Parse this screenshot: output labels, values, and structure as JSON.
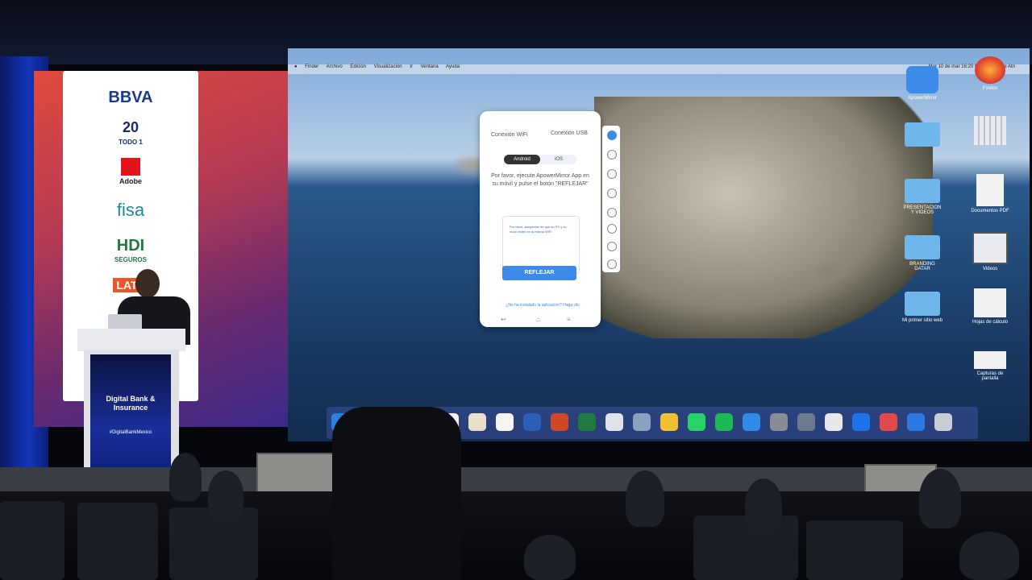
{
  "sponsors": {
    "bbva": "BBVA",
    "todo1_number": "20",
    "todo1_text": "TODO 1",
    "adobe": "Adobe",
    "fisa": "fisa",
    "hdi": "HDI",
    "hdi_sub": "SEGUROS",
    "latam": "LATA"
  },
  "podium": {
    "event_title": "Digital Bank & Insurance",
    "hashtag": "#DigitalBankMexico"
  },
  "mac": {
    "menubar": [
      "Finder",
      "Archivo",
      "Edición",
      "Visualización",
      "Ir",
      "Ventana",
      "Ayuda"
    ],
    "status": "Mar 10 de mar 16:20  Nathan Zetune Atri"
  },
  "app_dialog": {
    "tab_wifi": "Conexión WiFi",
    "tab_usb": "Conexión USB",
    "os_android": "Android",
    "os_ios": "iOS",
    "instructions": "Por favor, ejecute ApowerMirror App en su móvil y pulse el botón \"REFLEJAR\"",
    "wifi_note": "Por favor, asegúrese de que su PC y su móvil estén en la misma WiFi",
    "button": "REFLEJAR",
    "help_link": "¿No ha instalado la aplicación? Haga clic"
  },
  "desktop_icons": [
    {
      "label": "ApowerMirror",
      "icon": "apowermirror-icon"
    },
    {
      "label": "Firefox",
      "icon": "firefox-icon"
    },
    {
      "label": "",
      "icon": "folder-icon"
    },
    {
      "label": "",
      "icon": "grid-app-icon"
    },
    {
      "label": "PRESENTACION Y VIDEOS",
      "icon": "folder-icon"
    },
    {
      "label": "Documentos PDF",
      "icon": "document-icon"
    },
    {
      "label": "BRANDING DATAR",
      "icon": "folder-icon"
    },
    {
      "label": "Videos",
      "icon": "video-icon"
    },
    {
      "label": "Mi primer sitio web",
      "icon": "folder-icon"
    },
    {
      "label": "Hojas de cálculo",
      "icon": "spreadsheet-icon"
    },
    {
      "label": "Capturas de pantalla",
      "icon": "screenshot-icon"
    }
  ],
  "dock_colors": [
    "#2d7fe0",
    "#f28a2a",
    "#9aa7b8",
    "#c9a24e",
    "#f4f4f4",
    "#e8e0c8",
    "#f5f5f5",
    "#2a5fb8",
    "#d24726",
    "#1f7a3f",
    "#dfe3ea",
    "#8aa0bd",
    "#f0c030",
    "#25d366",
    "#1db954",
    "#2f8ae8",
    "#888c94",
    "#6b7a8f",
    "#e8e8ec",
    "#1a73e8",
    "#e04a4a",
    "#2c7be5",
    "#c8ccd4"
  ]
}
